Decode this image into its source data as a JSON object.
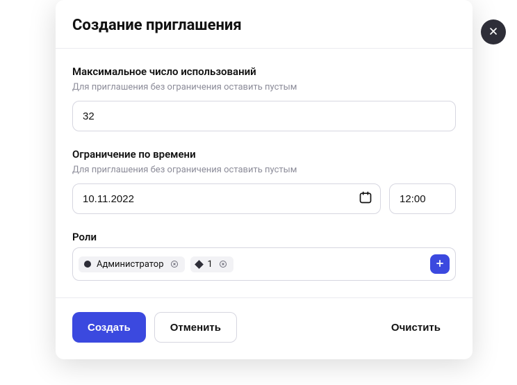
{
  "modal": {
    "title": "Создание приглашения"
  },
  "max_uses": {
    "label": "Максимальное число использований",
    "help": "Для приглашения без ограничения оставить пустым",
    "value": "32"
  },
  "time_limit": {
    "label": "Ограничение по времени",
    "help": "Для приглашения без ограничения оставить пустым",
    "date_value": "10.11.2022",
    "time_value": "12:00"
  },
  "roles": {
    "label": "Роли",
    "chips": [
      {
        "name": "Администратор",
        "shape": "dot"
      },
      {
        "name": "1",
        "shape": "diamond"
      }
    ]
  },
  "footer": {
    "create": "Создать",
    "cancel": "Отменить",
    "clear": "Очистить"
  }
}
